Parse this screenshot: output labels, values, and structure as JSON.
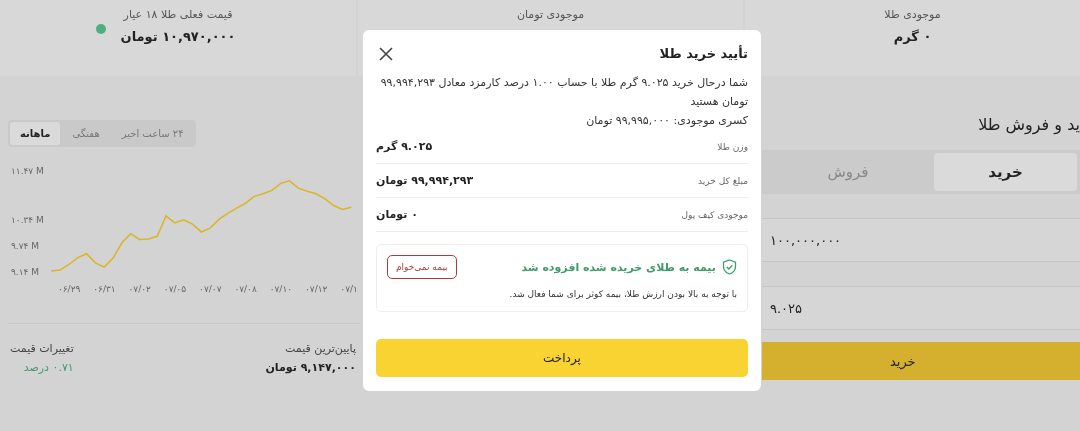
{
  "stats": [
    {
      "label": "موجودی طلا",
      "value": "۰ گرم",
      "live": false
    },
    {
      "label": "موجودی تومان",
      "live": false
    },
    {
      "label": "قیمت فعلی طلا ۱۸ عیار",
      "value": "۱۰,۹۷۰,۰۰۰ تومان",
      "live": true
    }
  ],
  "trade_panel": {
    "title": "ید و فروش طلا",
    "tabs": [
      {
        "label": "خرید",
        "selected": true
      },
      {
        "label": "فروش",
        "selected": false
      }
    ],
    "fields": [
      {
        "value": "۱۰۰,۰۰۰,۰۰۰"
      },
      {
        "value": "۹.۰۲۵"
      }
    ],
    "submit": "خرید"
  },
  "chart_panel": {
    "ranges": [
      {
        "label": "۲۴ ساعت اخیر",
        "selected": false
      },
      {
        "label": "هفتگی",
        "selected": false
      },
      {
        "label": "ماهانه",
        "selected": true
      }
    ],
    "chart_data": {
      "type": "line",
      "ylim": [
        9.14,
        11.47
      ],
      "categories": [
        null,
        null,
        "۰۶/۲۹",
        null,
        null,
        null,
        "۰۶/۳۱",
        null,
        null,
        null,
        "۰۷/۰۲",
        null,
        null,
        null,
        "۰۷/۰۵",
        null,
        null,
        null,
        "۰۷/۰۷",
        null,
        null,
        null,
        "۰۷/۰۸",
        null,
        null,
        null,
        "۰۷/۱۰",
        null,
        null,
        null,
        "۰۷/۱۲",
        null,
        null,
        null,
        "۰۷/۱"
      ],
      "series": [
        {
          "color": "#d8b626",
          "values": [
            9.14,
            9.16,
            9.29,
            9.45,
            9.54,
            9.33,
            9.23,
            9.44,
            9.79,
            10.0,
            9.87,
            9.88,
            9.94,
            10.41,
            10.25,
            10.32,
            10.22,
            10.04,
            10.13,
            10.33,
            10.47,
            10.59,
            10.7,
            10.86,
            10.92,
            11.0,
            11.16,
            11.22,
            11.05,
            10.98,
            10.92,
            10.81,
            10.65,
            10.56,
            10.61
          ]
        }
      ],
      "yticks": [
        {
          "value": 11.47,
          "label": "۱۱.۴۷ M"
        },
        {
          "value": 10.34,
          "label": "۱۰.۳۴ M"
        },
        {
          "value": 9.74,
          "label": "۹.۷۴ M"
        },
        {
          "value": 9.14,
          "label": "۹.۱۴ M"
        }
      ]
    },
    "summary": [
      {
        "label": "پایین‌ترین قیمت",
        "value": "۹,۱۴۷,۰۰۰ تومان",
        "kind": "plain"
      },
      {
        "label": "تغییرات قیمت",
        "value": "۰.۷۱ درصد",
        "kind": "change"
      }
    ]
  },
  "dialog": {
    "title": "تأیید خرید طلا",
    "message": "شما درحال خرید ۹.۰۲۵ گرم طلا با حساب ۱.۰۰ درصد کارمزد معادل ۹۹,۹۹۴,۲۹۳ تومان هستید",
    "shortfall": "کسری موجودی: ۹۹,۹۹۵,۰۰۰ تومان",
    "rows": [
      {
        "label": "وزن طلا",
        "value": "۹.۰۲۵ گرم"
      },
      {
        "label": "مبلغ کل خرید",
        "value": "۹۹,۹۹۴,۲۹۳ تومان"
      },
      {
        "label": "موجودی کیف پول",
        "value": "۰ تومان"
      }
    ],
    "insurance": {
      "title": "بیمه به طلای خریده شده افزوده شد",
      "decline": "بیمه نمی‌خوام",
      "note": "با توجه به بالا بودن ارزش طلا، بیمه کوثر برای شما فعال شد."
    },
    "pay": "پرداخت"
  }
}
